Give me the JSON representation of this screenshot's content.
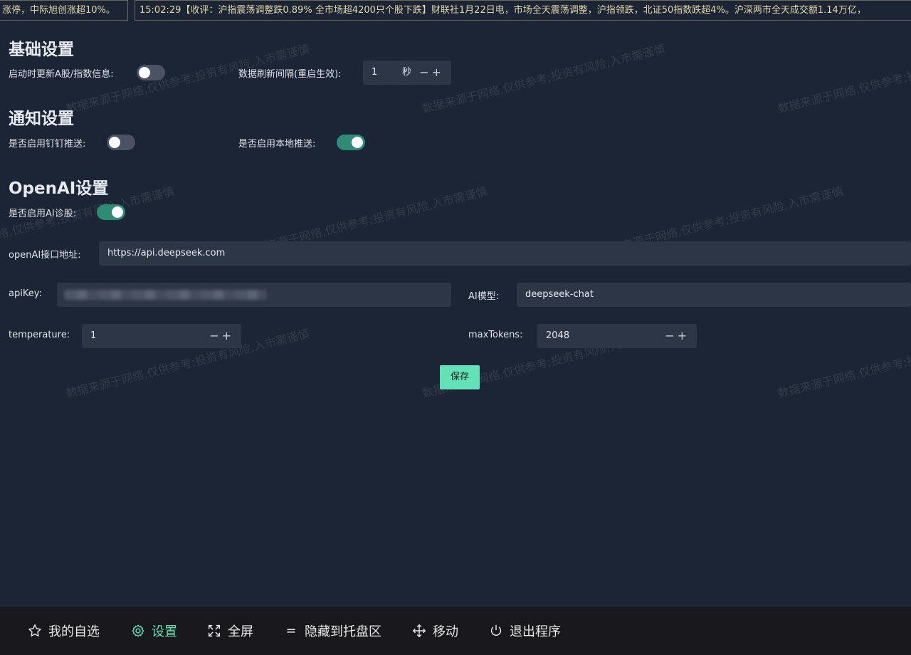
{
  "ticker": {
    "item1": "涨停，中际旭创涨超10%。",
    "item2": "15:02:29【收评：沪指震荡调整跌0.89% 全市场超4200只个股下跌】财联社1月22日电，市场全天震荡调整，沪指领跌，北证50指数跌超4%。沪深两市全天成交额1.14万亿，"
  },
  "basic": {
    "title": "基础设置",
    "update_label": "启动时更新A股/指数信息:",
    "update_on": false,
    "refresh_label": "数据刷新间隔(重启生效):",
    "refresh_value": "1",
    "refresh_unit": "秒"
  },
  "notify": {
    "title": "通知设置",
    "dingtalk_label": "是否启用钉钉推送:",
    "dingtalk_on": false,
    "local_label": "是否启用本地推送:",
    "local_on": true
  },
  "openai": {
    "title": "OpenAI设置",
    "enable_label": "是否启用AI诊股:",
    "enable_on": true,
    "url_label": "openAI接口地址:",
    "url_value": "https://api.deepseek.com",
    "apikey_label": "apiKey:",
    "model_label": "AI模型:",
    "model_value": "deepseek-chat",
    "temperature_label": "temperature:",
    "temperature_value": "1",
    "maxtokens_label": "maxTokens:",
    "maxtokens_value": "2048"
  },
  "stepper_symbols": "−+",
  "save_label": "保存",
  "watermark": "数据来源于网络,仅供参考;投资有风险,入市需谨慎",
  "nav": [
    {
      "label": "我的自选",
      "icon": "star-icon"
    },
    {
      "label": "设置",
      "icon": "gear-icon"
    },
    {
      "label": "全屏",
      "icon": "fullscreen-icon"
    },
    {
      "label": "隐藏到托盘区",
      "icon": "equals-icon"
    },
    {
      "label": "移动",
      "icon": "move-icon"
    },
    {
      "label": "退出程序",
      "icon": "power-icon"
    }
  ],
  "colors": {
    "accent": "#63e2b7",
    "toggle_on": "#2e8b74",
    "background": "#1b2535"
  }
}
